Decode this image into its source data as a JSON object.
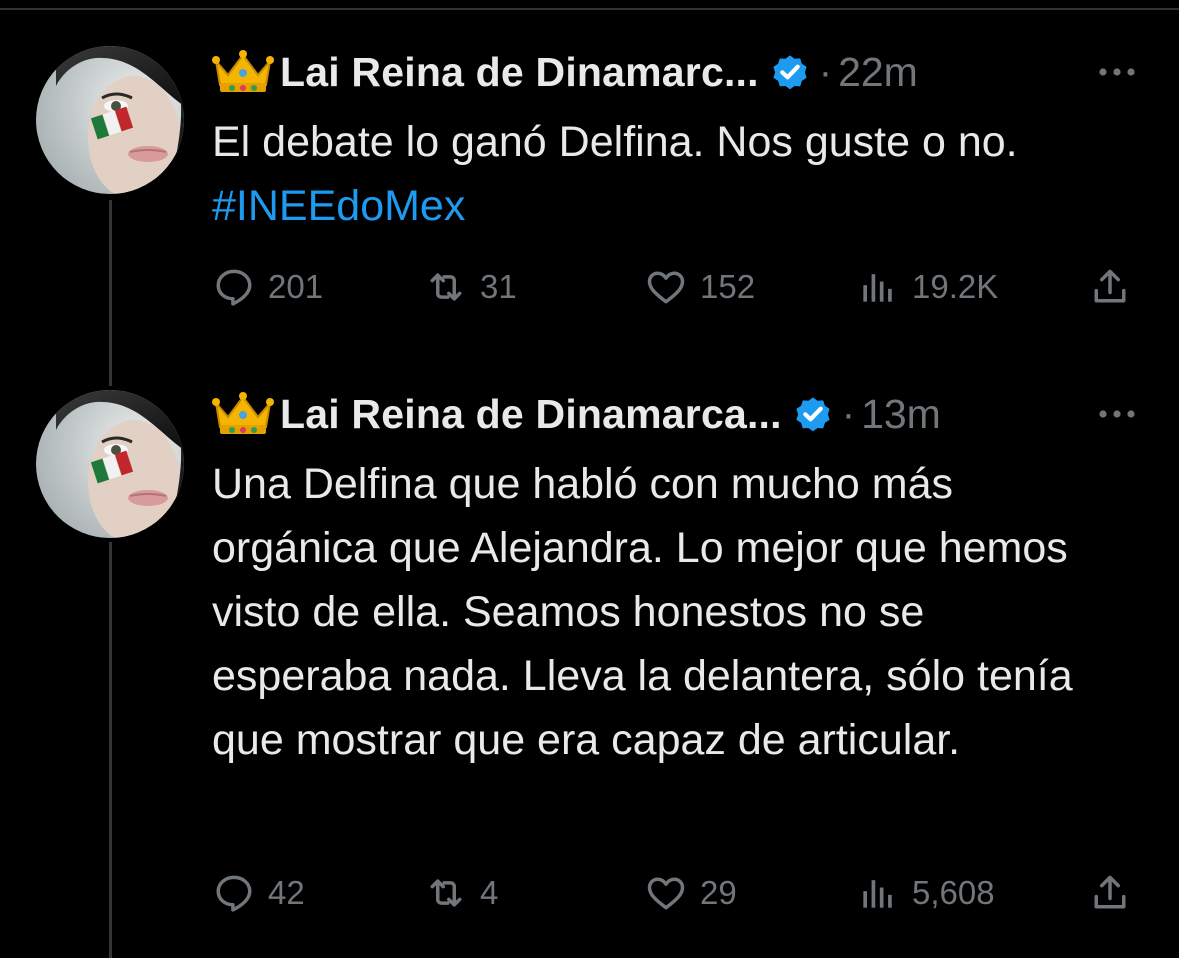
{
  "colors": {
    "background": "#000000",
    "text_primary": "#e7e9ea",
    "text_secondary": "#71767b",
    "link": "#1d9bf0",
    "verified_badge": "#1d9bf0",
    "thread_line": "#333639"
  },
  "tweets": [
    {
      "author": {
        "display_name": "Lai Reina de Dinamarc...",
        "name_emoji_icon": "crown-icon",
        "verified": true
      },
      "separator": "·",
      "timestamp": "22m",
      "text_plain": "El debate lo ganó Delfina. Nos guste o no. ",
      "hashtag": "#INEEdoMex",
      "metrics": {
        "replies": "201",
        "retweets": "31",
        "likes": "152",
        "views": "19.2K"
      }
    },
    {
      "author": {
        "display_name": "Lai Reina de Dinamarca...",
        "name_emoji_icon": "crown-icon",
        "verified": true
      },
      "separator": "·",
      "timestamp": "13m",
      "text_plain": "Una Delfina que habló con mucho más orgánica que Alejandra. Lo mejor que hemos visto de ella. Seamos honestos no se esperaba nada. Lleva la delantera, sólo tenía que mostrar que era capaz de articular.",
      "hashtag": "",
      "metrics": {
        "replies": "42",
        "retweets": "4",
        "likes": "29",
        "views": "5,608"
      }
    }
  ]
}
